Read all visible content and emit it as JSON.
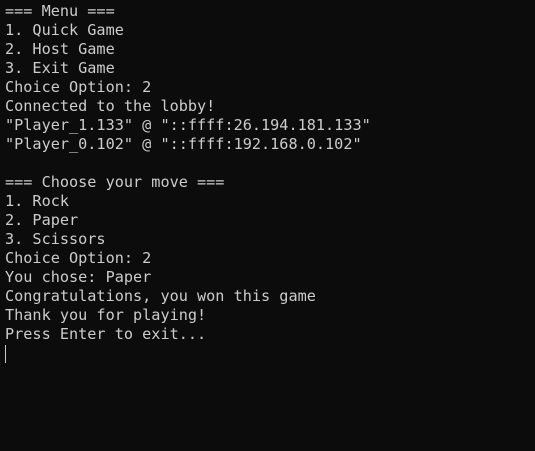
{
  "terminal": {
    "colors": {
      "background": "#0c0c0c",
      "foreground": "#cccccc"
    },
    "lines": [
      "=== Menu ===",
      "1. Quick Game",
      "2. Host Game",
      "3. Exit Game",
      "Choice Option: 2",
      "Connected to the lobby!",
      "\"Player_1.133\" @ \"::ffff:26.194.181.133\"",
      "\"Player_0.102\" @ \"::ffff:192.168.0.102\"",
      "",
      "=== Choose your move ===",
      "1. Rock",
      "2. Paper",
      "3. Scissors",
      "Choice Option: 2",
      "You chose: Paper",
      "Congratulations, you won this game",
      "Thank you for playing!",
      "Press Enter to exit..."
    ]
  }
}
